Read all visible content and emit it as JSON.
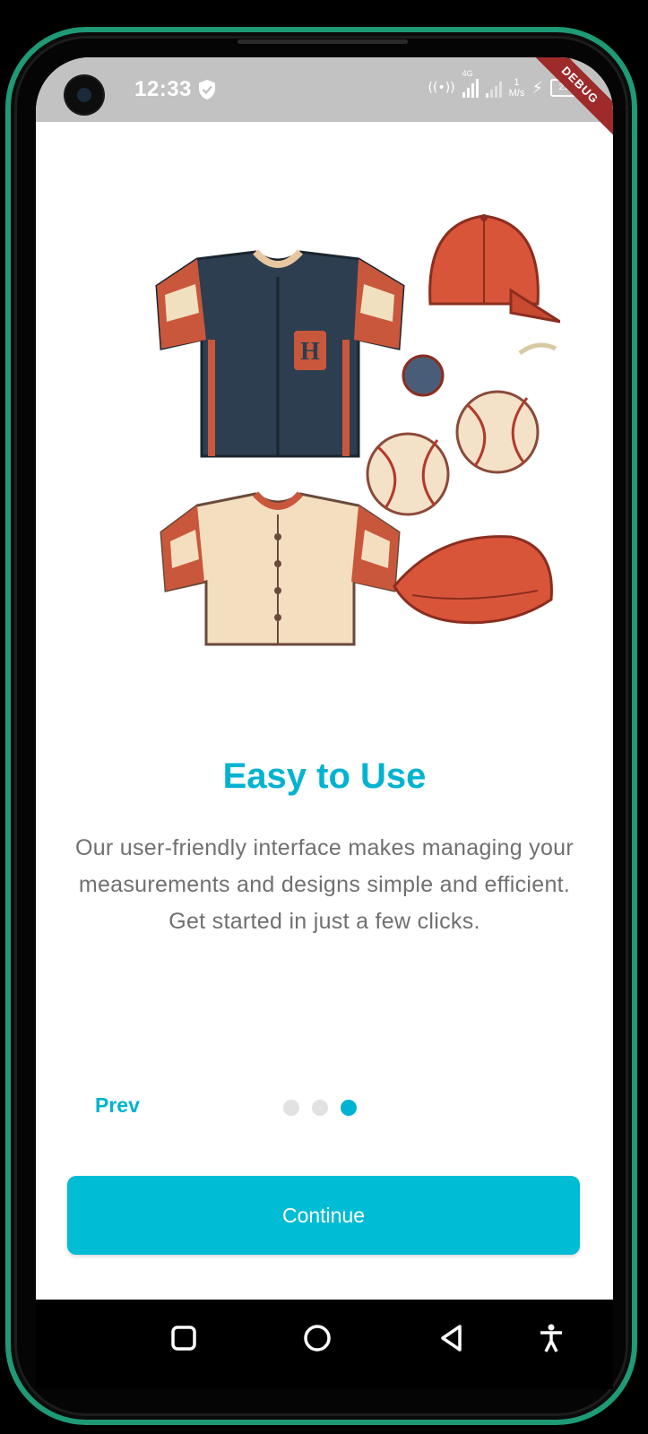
{
  "status_bar": {
    "time": "12:33",
    "network_type": "4G",
    "speed_value": "1",
    "speed_unit": "M/s",
    "battery": "21",
    "debug_label": "DEBUG"
  },
  "onboarding": {
    "title": "Easy to Use",
    "description": "Our user-friendly interface makes managing your measurements and designs simple and efficient. Get started in just a few clicks.",
    "prev_label": "Prev",
    "continue_label": "Continue",
    "page_total": 3,
    "page_current": 3
  },
  "colors": {
    "accent": "#00b3d1",
    "button": "#00bcd4",
    "body_text": "#707070",
    "status_bar": "#c2c2c2",
    "phone_frame": "#1f9a76"
  },
  "icons": {
    "status": [
      "shield-icon",
      "hotspot-icon",
      "signal-icon",
      "charging-icon",
      "battery-icon"
    ],
    "nav": [
      "recents-icon",
      "home-icon",
      "back-icon",
      "accessibility-icon"
    ]
  }
}
